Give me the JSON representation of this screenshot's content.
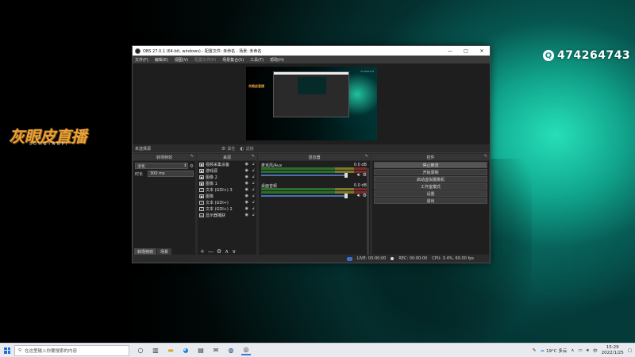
{
  "desktop": {
    "qq_number": "474264743",
    "qq_icon": "Q",
    "logo_main": "灰眼皮直播",
    "logo_sub": "LOHGYANPI"
  },
  "obs": {
    "title": "OBS 27.0.1 (64-bit, windows) - 配置文件: 未命名 - 场景: 未命名",
    "window_controls": {
      "minimize": "—",
      "maximize": "□",
      "close": "✕"
    },
    "menu": [
      {
        "label": "文件(F)",
        "enabled": true
      },
      {
        "label": "编辑(E)",
        "enabled": true
      },
      {
        "label": "视图(V)",
        "enabled": true
      },
      {
        "label": "配置文件(P)",
        "enabled": false
      },
      {
        "label": "场景集合(S)",
        "enabled": true
      },
      {
        "label": "工具(T)",
        "enabled": true
      },
      {
        "label": "帮助(H)",
        "enabled": true
      }
    ],
    "preview": {
      "mini_logo": "灰眼皮直播",
      "mini_tag": "474264743"
    },
    "scene_bar": {
      "label": "未选择源",
      "properties": "属性",
      "filters": "滤镜"
    },
    "docks": {
      "transitions": {
        "title": "转场特效",
        "selected": "淡化",
        "duration_label": "时长",
        "duration_value": "300 ms",
        "tab_transitions": "转场特效",
        "tab_scenes": "场景"
      },
      "sources": {
        "title": "来源",
        "items": [
          {
            "icon": "▣",
            "name": "视频采集设备"
          },
          {
            "icon": "▣",
            "name": "游戏源"
          },
          {
            "icon": "▣",
            "name": "图像 2"
          },
          {
            "icon": "▣",
            "name": "图像 1"
          },
          {
            "icon": "T",
            "name": "文本 (GDI+) 3"
          },
          {
            "icon": "▣",
            "name": "图像"
          },
          {
            "icon": "T",
            "name": "文本 (GDI+)"
          },
          {
            "icon": "T",
            "name": "文本 (GDI+) 2"
          },
          {
            "icon": "▭",
            "name": "显示器捕获"
          }
        ],
        "toolbar": [
          "+",
          "—",
          "⚙",
          "∧",
          "∨"
        ]
      },
      "mixer": {
        "title": "混音器",
        "channels": [
          {
            "name": "麦克风/Aux",
            "db": "0.0 dB"
          },
          {
            "name": "桌面音频",
            "db": "0.0 dB"
          }
        ]
      },
      "controls": {
        "title": "控件",
        "buttons": [
          "停止推流",
          "开始录制",
          "启动虚拟摄像机",
          "工作室模式",
          "设置",
          "退出"
        ]
      }
    },
    "status": {
      "live": "LIVE: 00:00:00",
      "rec": "REC: 00:00:00",
      "cpu": "CPU: 3.4%, 60.00 fps"
    }
  },
  "taskbar": {
    "search_placeholder": "在这里输入你要搜索的内容",
    "weather": "19°C 多云",
    "time": "15:29",
    "date": "2022/1/25",
    "lang": "中"
  }
}
